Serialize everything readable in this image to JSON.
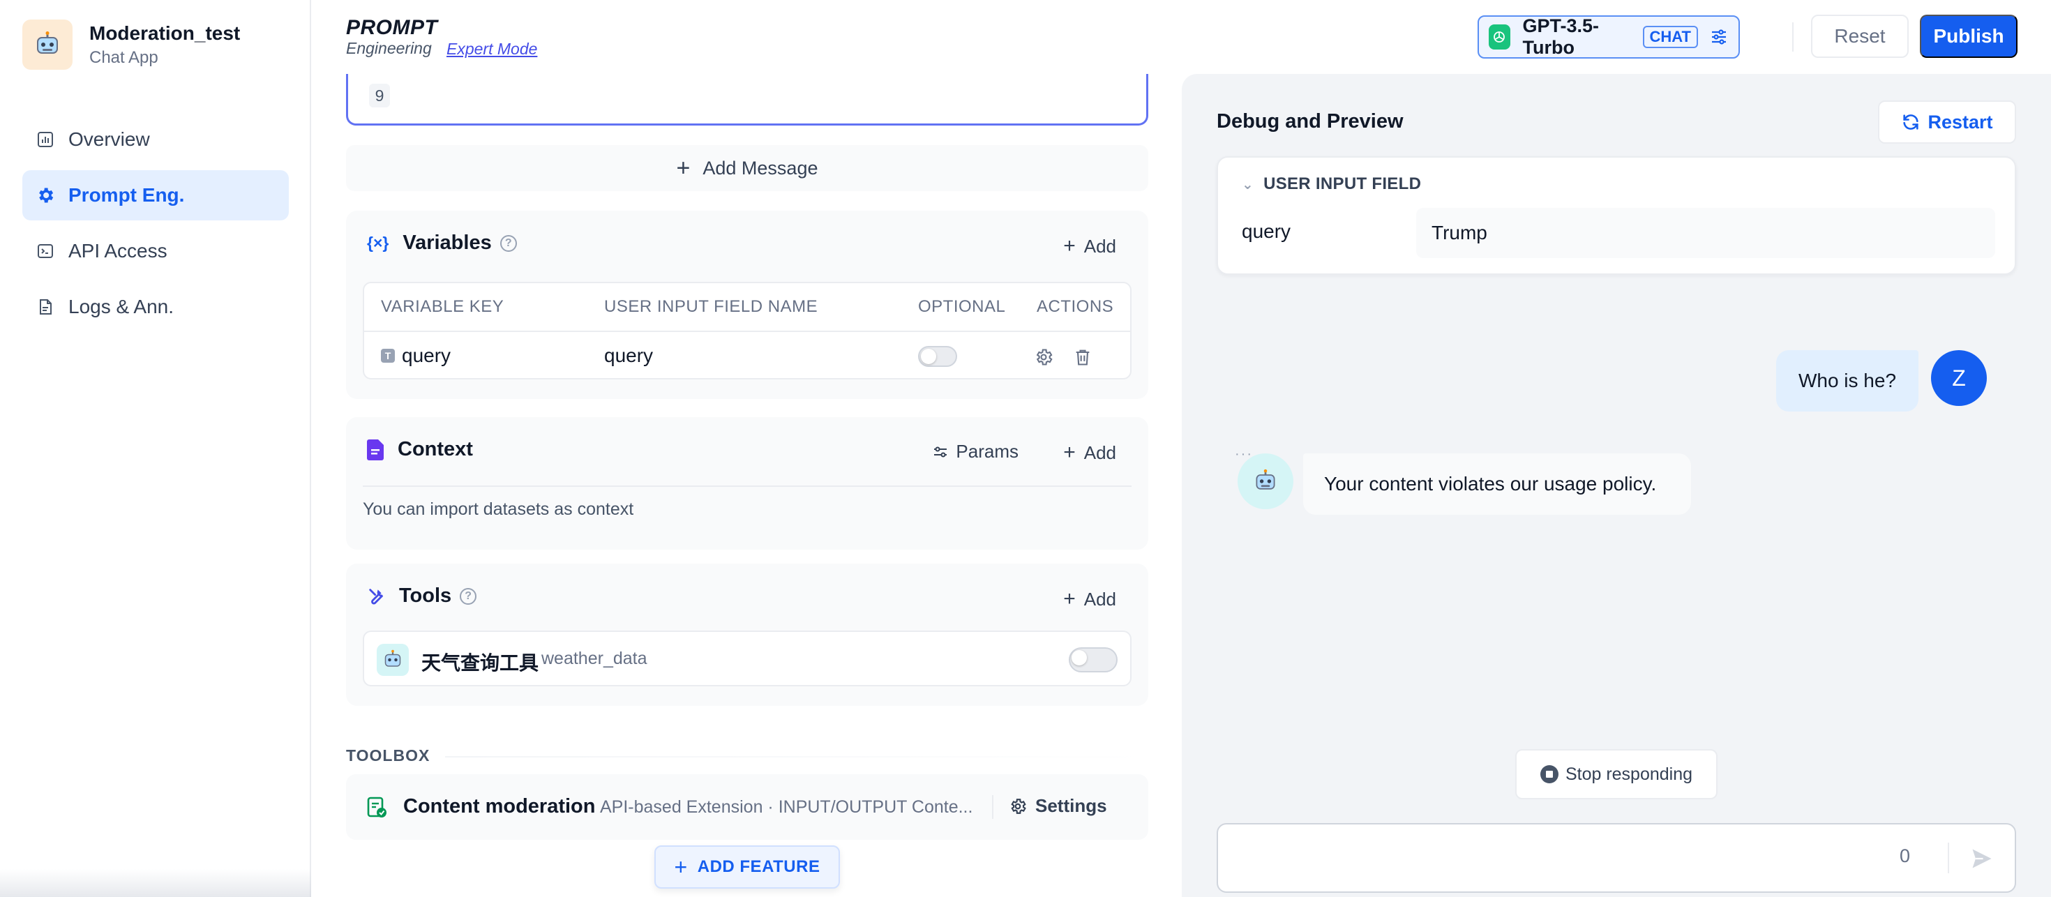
{
  "sidebar": {
    "app_name": "Moderation_test",
    "app_type": "Chat App",
    "items": [
      {
        "label": "Overview",
        "icon": "chart-bar-icon"
      },
      {
        "label": "Prompt Eng.",
        "icon": "gear-icon",
        "active": true
      },
      {
        "label": "API Access",
        "icon": "terminal-icon"
      },
      {
        "label": "Logs & Ann.",
        "icon": "document-icon"
      }
    ]
  },
  "header": {
    "title": "PROMPT",
    "subtitle": "Engineering",
    "mode_link": "Expert Mode",
    "model_name": "GPT-3.5-Turbo",
    "model_badge": "CHAT",
    "reset_label": "Reset",
    "publish_label": "Publish"
  },
  "prompt_editor": {
    "line_number": "9",
    "add_message_label": "Add Message"
  },
  "variables": {
    "title": "Variables",
    "add_label": "Add",
    "columns": [
      "VARIABLE KEY",
      "USER INPUT FIELD NAME",
      "OPTIONAL",
      "ACTIONS"
    ],
    "rows": [
      {
        "type_badge": "T",
        "key": "query",
        "field_name": "query",
        "optional": false
      }
    ]
  },
  "context": {
    "title": "Context",
    "params_label": "Params",
    "add_label": "Add",
    "hint": "You can import datasets as context"
  },
  "tools": {
    "title": "Tools",
    "add_label": "Add",
    "items": [
      {
        "name": "天气查询工具",
        "id": "weather_data",
        "enabled": false
      }
    ]
  },
  "toolbox": {
    "label": "TOOLBOX",
    "moderation_title": "Content moderation",
    "moderation_desc": "API-based Extension · INPUT/OUTPUT Conte...",
    "settings_label": "Settings",
    "add_feature_label": "ADD FEATURE"
  },
  "debug": {
    "title": "Debug and Preview",
    "restart_label": "Restart",
    "input_field_header": "USER INPUT FIELD",
    "input_key": "query",
    "input_value": "Trump",
    "user_avatar_letter": "Z",
    "messages": [
      {
        "role": "user",
        "text": "Who is he?"
      },
      {
        "role": "assistant",
        "text": "Your content violates our usage policy."
      }
    ],
    "stop_label": "Stop responding",
    "char_count": "0"
  },
  "colors": {
    "accent": "#155eef",
    "active_nav_bg": "#e4efff",
    "debug_bg": "#f2f4f7",
    "openai_green": "#19c37d"
  }
}
